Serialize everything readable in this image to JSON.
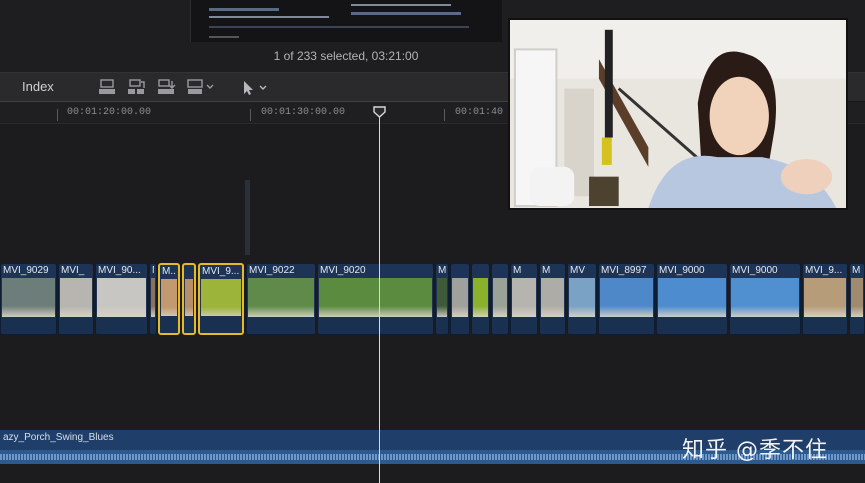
{
  "browser": {
    "selection_info": "1 of 233 selected, 03:21:00"
  },
  "toolbar": {
    "index_label": "Index",
    "tools": [
      "append-clip-icon",
      "insert-clip-icon",
      "overwrite-clip-icon",
      "connect-clip-icon"
    ],
    "select_tool": "arrow-icon"
  },
  "ruler": {
    "timecodes": [
      "00:01:20:00.00",
      "00:01:30:00.00",
      "00:01:40"
    ]
  },
  "clips": [
    {
      "label": "MVI_9029",
      "selected": false,
      "color": "#6d7d7a"
    },
    {
      "label": "MVI_",
      "selected": false,
      "color": "#b7b5b0"
    },
    {
      "label": "MVI_90...",
      "selected": false,
      "color": "#c8c6c2"
    },
    {
      "label": "M",
      "selected": false,
      "color": "#8a7060"
    },
    {
      "label": "M...",
      "selected": true,
      "color": "#c29a70"
    },
    {
      "label": "",
      "selected": true,
      "color": "#b68e6a"
    },
    {
      "label": "MVI_9...",
      "selected": true,
      "color": "#9cb43a"
    },
    {
      "label": "MVI_9022",
      "selected": false,
      "color": "#5f8a49"
    },
    {
      "label": "MVI_9020",
      "selected": false,
      "color": "#5a8b3f"
    },
    {
      "label": "M",
      "selected": false,
      "color": "#3f5a38"
    },
    {
      "label": "",
      "selected": false,
      "color": "#a0a09c"
    },
    {
      "label": "",
      "selected": false,
      "color": "#8bb02c"
    },
    {
      "label": "",
      "selected": false,
      "color": "#9aa298"
    },
    {
      "label": "M",
      "selected": false,
      "color": "#b6b4af"
    },
    {
      "label": "M",
      "selected": false,
      "color": "#aeaca6"
    },
    {
      "label": "MV",
      "selected": false,
      "color": "#7aa2c4"
    },
    {
      "label": "MVI_8997",
      "selected": false,
      "color": "#4e88c9"
    },
    {
      "label": "MVI_9000",
      "selected": false,
      "color": "#4c8ccf"
    },
    {
      "label": "MVI_9000",
      "selected": false,
      "color": "#5190d0"
    },
    {
      "label": "MVI_9...",
      "selected": false,
      "color": "#b79c7a"
    },
    {
      "label": "M",
      "selected": false,
      "color": "#a08a70"
    }
  ],
  "audio": {
    "label": "azy_Porch_Swing_Blues"
  },
  "watermark": "知乎 @季不住"
}
